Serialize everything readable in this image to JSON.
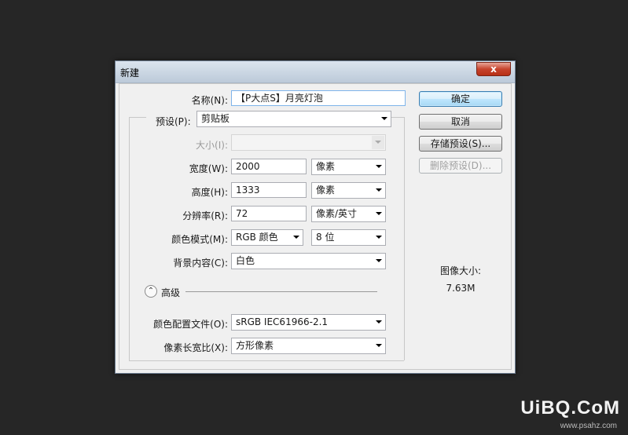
{
  "dialog": {
    "title": "新建",
    "close_glyph": "x",
    "name": {
      "label": "名称(N):",
      "value": "【P大点S】月亮灯泡"
    },
    "preset": {
      "label": "预设(P):",
      "value": "剪贴板"
    },
    "size": {
      "label": "大小(I):",
      "value": ""
    },
    "width": {
      "label": "宽度(W):",
      "value": "2000",
      "unit": "像素"
    },
    "height": {
      "label": "高度(H):",
      "value": "1333",
      "unit": "像素"
    },
    "resolution": {
      "label": "分辨率(R):",
      "value": "72",
      "unit": "像素/英寸"
    },
    "color_mode": {
      "label": "颜色模式(M):",
      "value": "RGB 颜色",
      "depth": "8 位"
    },
    "background": {
      "label": "背景内容(C):",
      "value": "白色"
    },
    "advanced": {
      "label": "高级",
      "glyph": "⌃"
    },
    "color_profile": {
      "label": "颜色配置文件(O):",
      "value": "sRGB IEC61966-2.1"
    },
    "pixel_aspect": {
      "label": "像素长宽比(X):",
      "value": "方形像素"
    },
    "buttons": {
      "ok": "确定",
      "cancel": "取消",
      "save_preset": "存储预设(S)...",
      "delete_preset": "删除预设(D)..."
    },
    "image_size": {
      "label": "图像大小:",
      "value": "7.63M"
    }
  },
  "watermark": {
    "text": "UiBQ.CoM",
    "sub": "www.psahz.com"
  }
}
